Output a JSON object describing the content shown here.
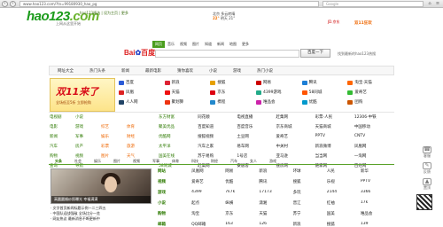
{
  "browser": {
    "url": "www.hao123.com/?tn=99180930_hao_pg",
    "search_placeholder": "Google"
  },
  "header": {
    "logo": "hao123",
    "logo_tld": ".com",
    "logo_sub": "上网从这里开始",
    "toplinks": "hao123精选  |  设为主页  |  更多  ",
    "weather_city": "北京",
    "weather_text": "多云转晴",
    "weather_temp": "22°",
    "weather_tomorrow": "明天 21°",
    "jd_text": "JD.京东",
    "cd_text": "双11狂欢"
  },
  "search": {
    "tabs": [
      "网页",
      "音乐",
      "视频",
      "图片",
      "知道",
      "新闻",
      "地图",
      "更多"
    ],
    "logo": "Bai",
    "logo2": "百度",
    "button": "百度一下",
    "right": "找到最新的hao123热搜"
  },
  "bar2": [
    "网址大全",
    "热门头条",
    "新闻",
    "最新电影",
    "猜你喜欢",
    "小说",
    "游戏",
    "热门小说"
  ],
  "ad": {
    "big": "双11来了",
    "small": "全场低至5折 立即抢购"
  },
  "sites": [
    {
      "t": "百度",
      "c": "#2a5bd7"
    },
    {
      "t": "新浪",
      "c": "#d23"
    },
    {
      "t": "搜狐",
      "c": "#e6a000"
    },
    {
      "t": "网易",
      "c": "#c00"
    },
    {
      "t": "腾讯",
      "c": "#1c7ed6"
    },
    {
      "t": "淘宝·天猫",
      "c": "#f60"
    },
    {
      "t": "凤凰",
      "c": "#d22"
    },
    {
      "t": "天猫",
      "c": "#e11"
    },
    {
      "t": "京东",
      "c": "#d01"
    },
    {
      "t": "4399游戏",
      "c": "#2a8"
    },
    {
      "t": "58同城",
      "c": "#f50"
    },
    {
      "t": "爱奇艺",
      "c": "#3b3"
    },
    {
      "t": "人人网",
      "c": "#246"
    },
    {
      "t": "聚划算",
      "c": "#e31"
    },
    {
      "t": "携程",
      "c": "#28c"
    },
    {
      "t": "唯品会",
      "c": "#c2a"
    },
    {
      "t": "优酷",
      "c": "#09c"
    },
    {
      "t": "团购",
      "c": "#c50"
    }
  ],
  "leftcat": [
    [
      "电视剧",
      "小说",
      "",
      ""
    ],
    [
      "电影",
      "游戏",
      "综艺",
      "体育"
    ],
    [
      "新闻",
      "军事",
      "娱乐",
      "财经"
    ],
    [
      "汽车",
      "房产",
      "彩票",
      "旅游"
    ],
    [
      "购物",
      "视频",
      "图片",
      "天气"
    ],
    [
      "查询",
      "导航",
      "",
      ""
    ]
  ],
  "midlinks": [
    "东方财富",
    "同花顺",
    "电视直播",
    "赶集网",
    "彩票·人民",
    "12306·中铁",
    "聚美优品",
    "百度知道",
    "百度音乐",
    "京东商城",
    "天猫商城",
    "中国移动",
    "优酷网",
    "搜狐视频",
    "土豆网",
    "爱奇艺",
    "PPTV",
    "CNTV",
    "太平洋",
    "汽车之家",
    "易车网",
    "中关村",
    "新浪微博",
    "凤凰网",
    "国美在线",
    "苏宁易购",
    "1号店",
    "亚马逊",
    "当当网",
    "一淘网",
    "58同城",
    "赶集网",
    "安居客",
    "搜房网",
    "链家网",
    "百姓网"
  ],
  "tabrow": [
    "头条",
    "社会",
    "娱乐",
    "图片",
    "视频",
    "军事",
    "体育",
    "科技",
    "财经",
    "汽车",
    "女人",
    "游戏"
  ],
  "image_caption": "高圆圆婚纱照曝光 幸福满满",
  "news": [
    "文字首页新闻标题示例一二三四五",
    "中国队迎战强敌 全场比分一览",
    "网友热议 最新消息不断更新中"
  ],
  "lowerlist": [
    [
      "网站",
      "凤凰网",
      "网易",
      "新浪",
      "环球",
      "人民",
      "新华"
    ],
    [
      "视频",
      "爱奇艺",
      "优酷",
      "腾讯",
      "搜狐",
      "乐视",
      "PPTV"
    ],
    [
      "游戏",
      "4399",
      "7k7k",
      "17173",
      "多玩",
      "2144",
      "3366"
    ],
    [
      "小说",
      "起点",
      "纵横",
      "潇湘",
      "晋江",
      "红袖",
      "17k"
    ],
    [
      "购物",
      "淘宝",
      "京东",
      "天猫",
      "苏宁",
      "国美",
      "唯品会"
    ],
    [
      "邮箱",
      "QQ邮箱",
      "163",
      "126",
      "新浪",
      "搜狐",
      "139"
    ]
  ],
  "sidebar": [
    "客服",
    "反馈",
    "置顶"
  ],
  "colors": {
    "brand": "#1b9b1b",
    "accent": "#4a9d1d"
  }
}
